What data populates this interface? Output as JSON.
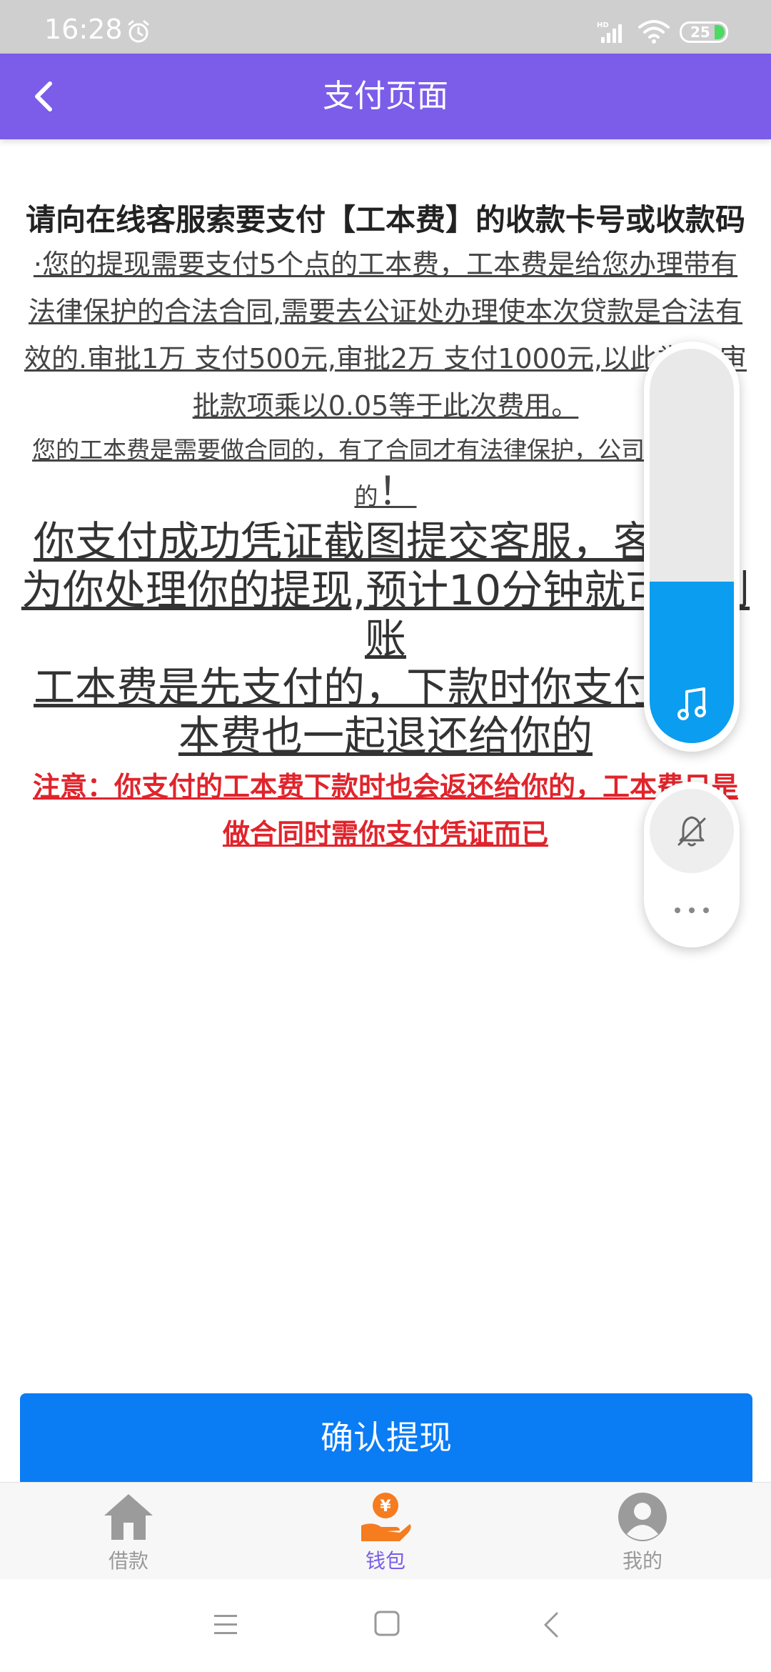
{
  "status_bar": {
    "time": "16:28",
    "battery": "25",
    "icons": [
      "alarm-icon",
      "hd-signal-icon",
      "wifi-icon",
      "battery-icon"
    ]
  },
  "header": {
    "title": "支付页面",
    "back_icon": "chevron-left-icon",
    "color": "#7b5de9"
  },
  "content": {
    "heading": "请向在线客服索要支付【工本费】的收款卡号或收款码",
    "paragraph1": "·您的提现需要支付5个点的工本费，工本费是给您办理带有法律保护的合法合同,需要去公证处办理使本次贷款是合法有效的.审批1万 支付500元,审批2万 支付1000元,以此类推,审批款项乘以0.05等于此次费用。",
    "paragraph2": "您的工本费是需要做合同的，有了合同才有法律保护，公司才能出款的",
    "paragraph2_end": "！",
    "paragraph3": "你支付成功凭证截图提交客服，客服会为你处理你的提现,预计10分钟就可以到账",
    "paragraph4": "工本费是先支付的，下款时你支付的工本费也一起退还给你的",
    "notice": "注意：你支付的工本费下款时也会返还给你的，工本费只是做合同时需你支付凭证而已"
  },
  "confirm_button": {
    "label": "确认提现",
    "color": "#0a7cf4"
  },
  "tab_bar": {
    "active": "钱包",
    "tabs": [
      {
        "label": "借款",
        "icon": "house-icon"
      },
      {
        "label": "钱包",
        "icon": "wallet-hand-coin-icon"
      },
      {
        "label": "我的",
        "icon": "user-avatar-icon"
      }
    ]
  },
  "nav_bar": {
    "icons": [
      "menu-icon",
      "home-square-icon",
      "back-triangle-icon"
    ]
  },
  "overlay": {
    "volume_level": 0.41,
    "volume_icon": "music-note-icon",
    "bell_icon": "bell-off-icon",
    "more_icon": "more-dots-icon"
  }
}
